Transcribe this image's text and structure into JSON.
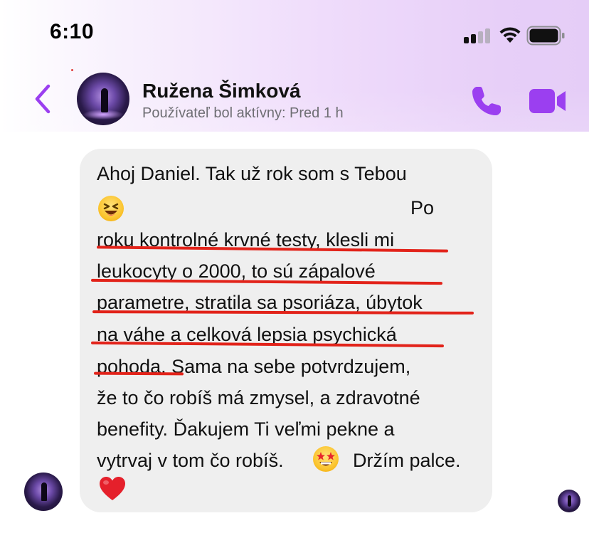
{
  "status_bar": {
    "time": "6:10",
    "signal_icon": "cellular-signal-icon",
    "wifi_icon": "wifi-icon",
    "battery_icon": "battery-icon"
  },
  "header": {
    "back_icon": "chevron-left-icon",
    "contact_name": "Ružena Šimková",
    "contact_status": "Používateľ bol aktívny: Pred 1 h",
    "call_icon": "phone-icon",
    "video_icon": "video-camera-icon",
    "accent_color": "#9b3ff0"
  },
  "message": {
    "lines": [
      "Ahoj Daniel. Tak už rok som s Tebou",
      "Po",
      "roku kontrolné krvné testy, klesli mi",
      "leukocyty o 2000, to sú zápalové",
      "parametre, stratila sa psoriáza, úbytok",
      "na váhe a celková lepsia psychická",
      "pohoda.  Sama na sebe potvrdzujem,",
      "že to čo robíš má zmysel, a zdravotné",
      "benefity. Ďakujem Ti veľmi pekne a",
      "vytrvaj v tom čo robíš.",
      "Držím palce."
    ],
    "emojis": [
      "laughing-face-emoji",
      "star-struck-emoji",
      "red-heart-emoji"
    ],
    "underline_color": "#e2231a",
    "bubble_color": "#efefef"
  }
}
